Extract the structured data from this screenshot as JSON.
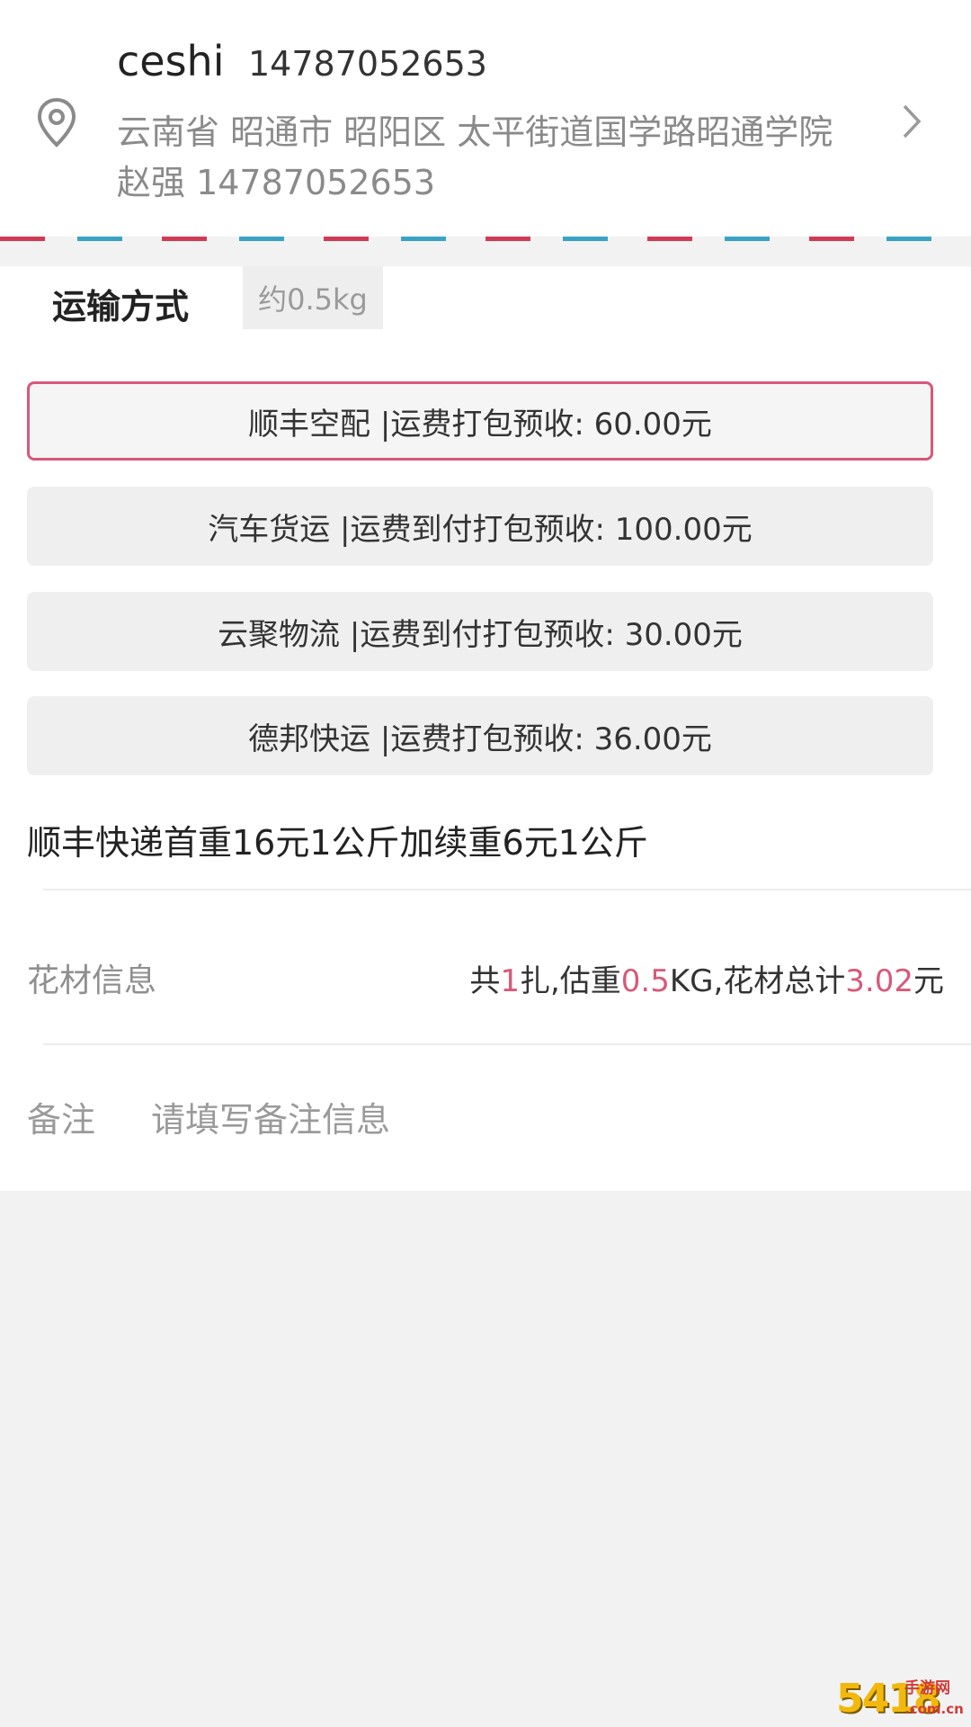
{
  "address": {
    "name": "ceshi",
    "phone": "14787052653",
    "detail": "云南省 昭通市 昭阳区 太平街道国学路昭通学院",
    "contact": "赵强 14787052653",
    "icon": "location-pin-icon",
    "chevron": "chevron-right-icon"
  },
  "shipping": {
    "title": "运输方式",
    "weight_badge": "约0.5kg",
    "options": [
      {
        "label": "顺丰空配 |运费打包预收: 60.00元",
        "selected": true
      },
      {
        "label": "汽车货运 |运费到付打包预收: 100.00元",
        "selected": false
      },
      {
        "label": "云聚物流 |运费到付打包预收: 30.00元",
        "selected": false
      },
      {
        "label": "德邦快运 |运费打包预收: 36.00元",
        "selected": false
      }
    ],
    "note": "顺丰快递首重16元1公斤加续重6元1公斤"
  },
  "flower_info": {
    "label": "花材信息",
    "prefix": "共",
    "bundle_count": "1",
    "bundle_unit": "扎,估重",
    "weight": "0.5",
    "weight_unit": "KG,花材总计",
    "total": "3.02",
    "currency": "元"
  },
  "remark": {
    "label": "备注",
    "placeholder": "请填写备注信息",
    "value": ""
  },
  "watermark": {
    "big": "5418",
    "small": "手游网",
    "domain": ".com.cn"
  },
  "colors": {
    "accent": "#d8587a",
    "airmail_red": "#d13a55",
    "airmail_blue": "#3aa3c4",
    "muted_text": "#8a8a8a"
  }
}
